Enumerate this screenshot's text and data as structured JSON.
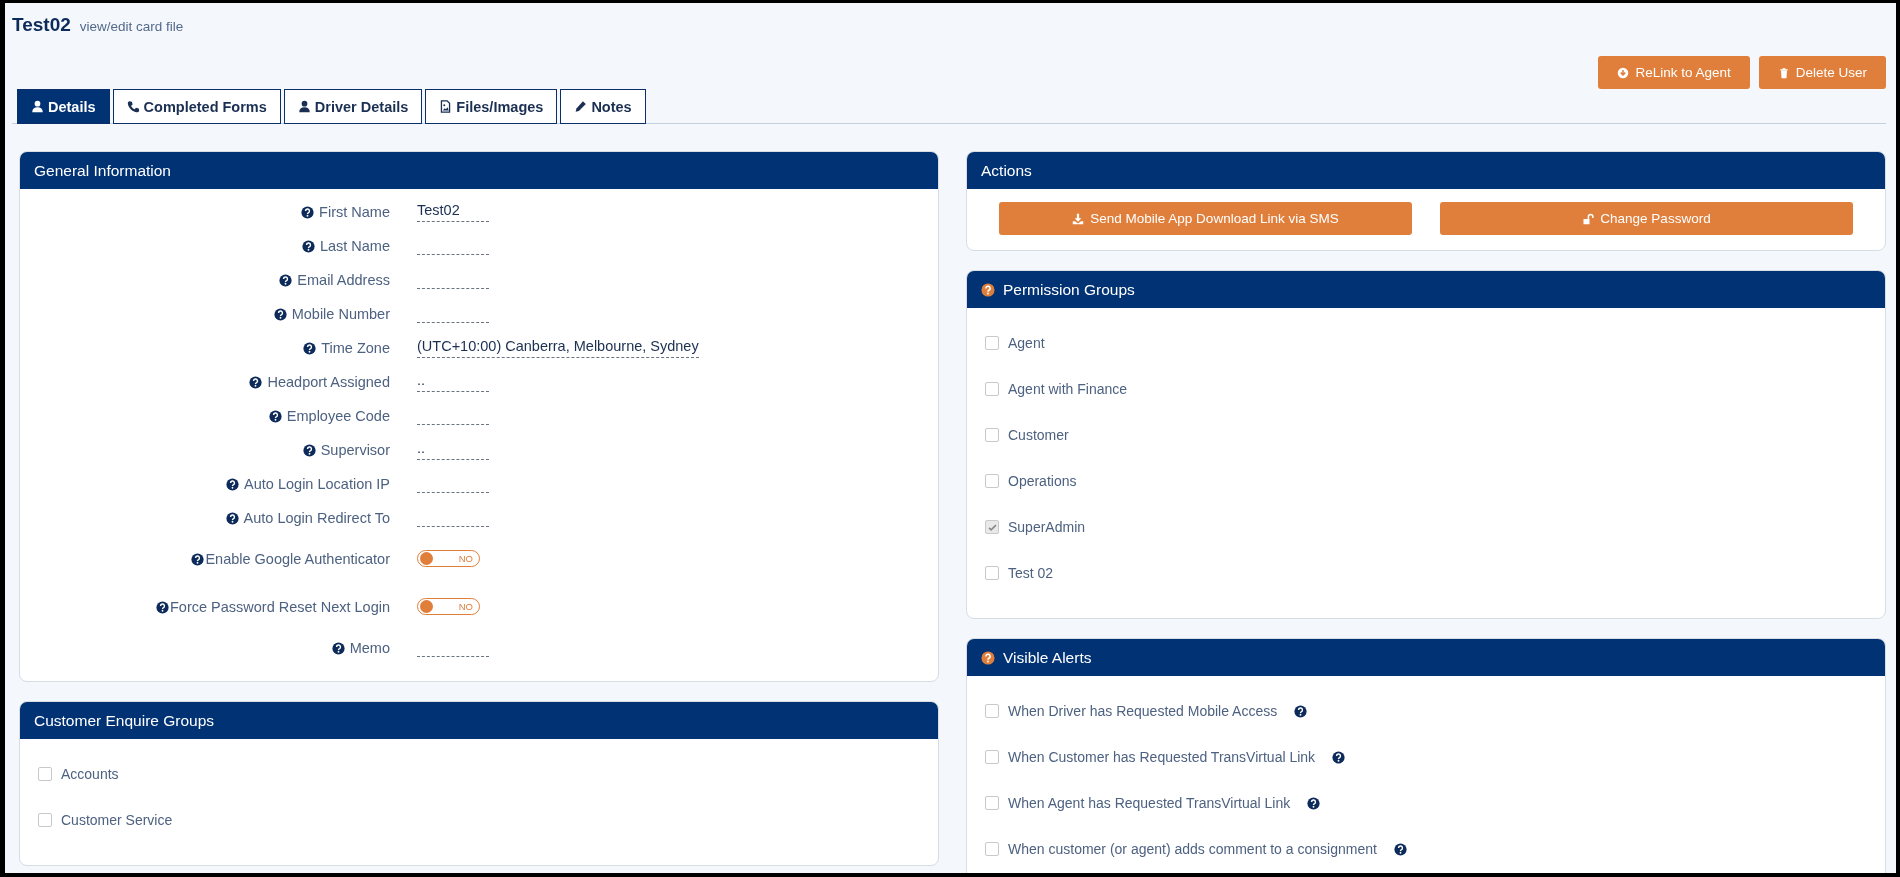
{
  "page": {
    "title": "Test02",
    "subtitle": "view/edit card file"
  },
  "header_buttons": [
    {
      "label": "ReLink to Agent"
    },
    {
      "label": "Delete User"
    }
  ],
  "tabs": [
    {
      "label": "Details",
      "selected": true
    },
    {
      "label": "Completed Forms",
      "selected": false
    },
    {
      "label": "Driver Details",
      "selected": false
    },
    {
      "label": "Files/Images",
      "selected": false
    },
    {
      "label": "Notes",
      "selected": false
    }
  ],
  "general_information": {
    "title": "General Information",
    "fields": [
      {
        "kind": "text",
        "label": "First Name",
        "value": "Test02"
      },
      {
        "kind": "text",
        "label": "Last Name"
      },
      {
        "kind": "text",
        "label": "Email Address"
      },
      {
        "kind": "text",
        "label": "Mobile Number"
      },
      {
        "kind": "text",
        "label": "Time Zone",
        "value": "(UTC+10:00) Canberra, Melbourne, Sydney"
      },
      {
        "kind": "text",
        "label": "Headport Assigned",
        "value": ".."
      },
      {
        "kind": "text",
        "label": "Employee Code"
      },
      {
        "kind": "text",
        "label": "Supervisor",
        "value": ".."
      },
      {
        "kind": "text",
        "label": "Auto Login Location IP"
      },
      {
        "kind": "text",
        "label": "Auto Login Redirect To"
      },
      {
        "kind": "toggle",
        "label": "Enable Google Authenticator",
        "on": false,
        "state_text": "NO"
      },
      {
        "kind": "toggle",
        "label": "Force Password Reset Next Login",
        "on": false,
        "state_text": "NO"
      },
      {
        "kind": "text",
        "label": "Memo"
      }
    ]
  },
  "customer_enquire_groups": {
    "title": "Customer Enquire Groups",
    "items": [
      {
        "label": "Accounts",
        "checked": false
      },
      {
        "label": "Customer Service",
        "checked": false
      }
    ]
  },
  "actions": {
    "title": "Actions",
    "buttons": [
      {
        "label": "Send Mobile App Download Link via SMS"
      },
      {
        "label": "Change Password"
      }
    ]
  },
  "permission_groups": {
    "title": "Permission Groups",
    "items": [
      {
        "label": "Agent",
        "checked": false
      },
      {
        "label": "Agent with Finance",
        "checked": false
      },
      {
        "label": "Customer",
        "checked": false
      },
      {
        "label": "Operations",
        "checked": false
      },
      {
        "label": "SuperAdmin",
        "checked": true
      },
      {
        "label": "Test 02",
        "checked": false
      }
    ]
  },
  "visible_alerts": {
    "title": "Visible Alerts",
    "items": [
      {
        "label": "When Driver has Requested Mobile Access",
        "checked": false
      },
      {
        "label": "When Customer has Requested TransVirtual Link",
        "checked": false
      },
      {
        "label": "When Agent has Requested TransVirtual Link",
        "checked": false
      },
      {
        "label": "When customer (or agent) adds comment to a consignment",
        "checked": false
      }
    ]
  }
}
